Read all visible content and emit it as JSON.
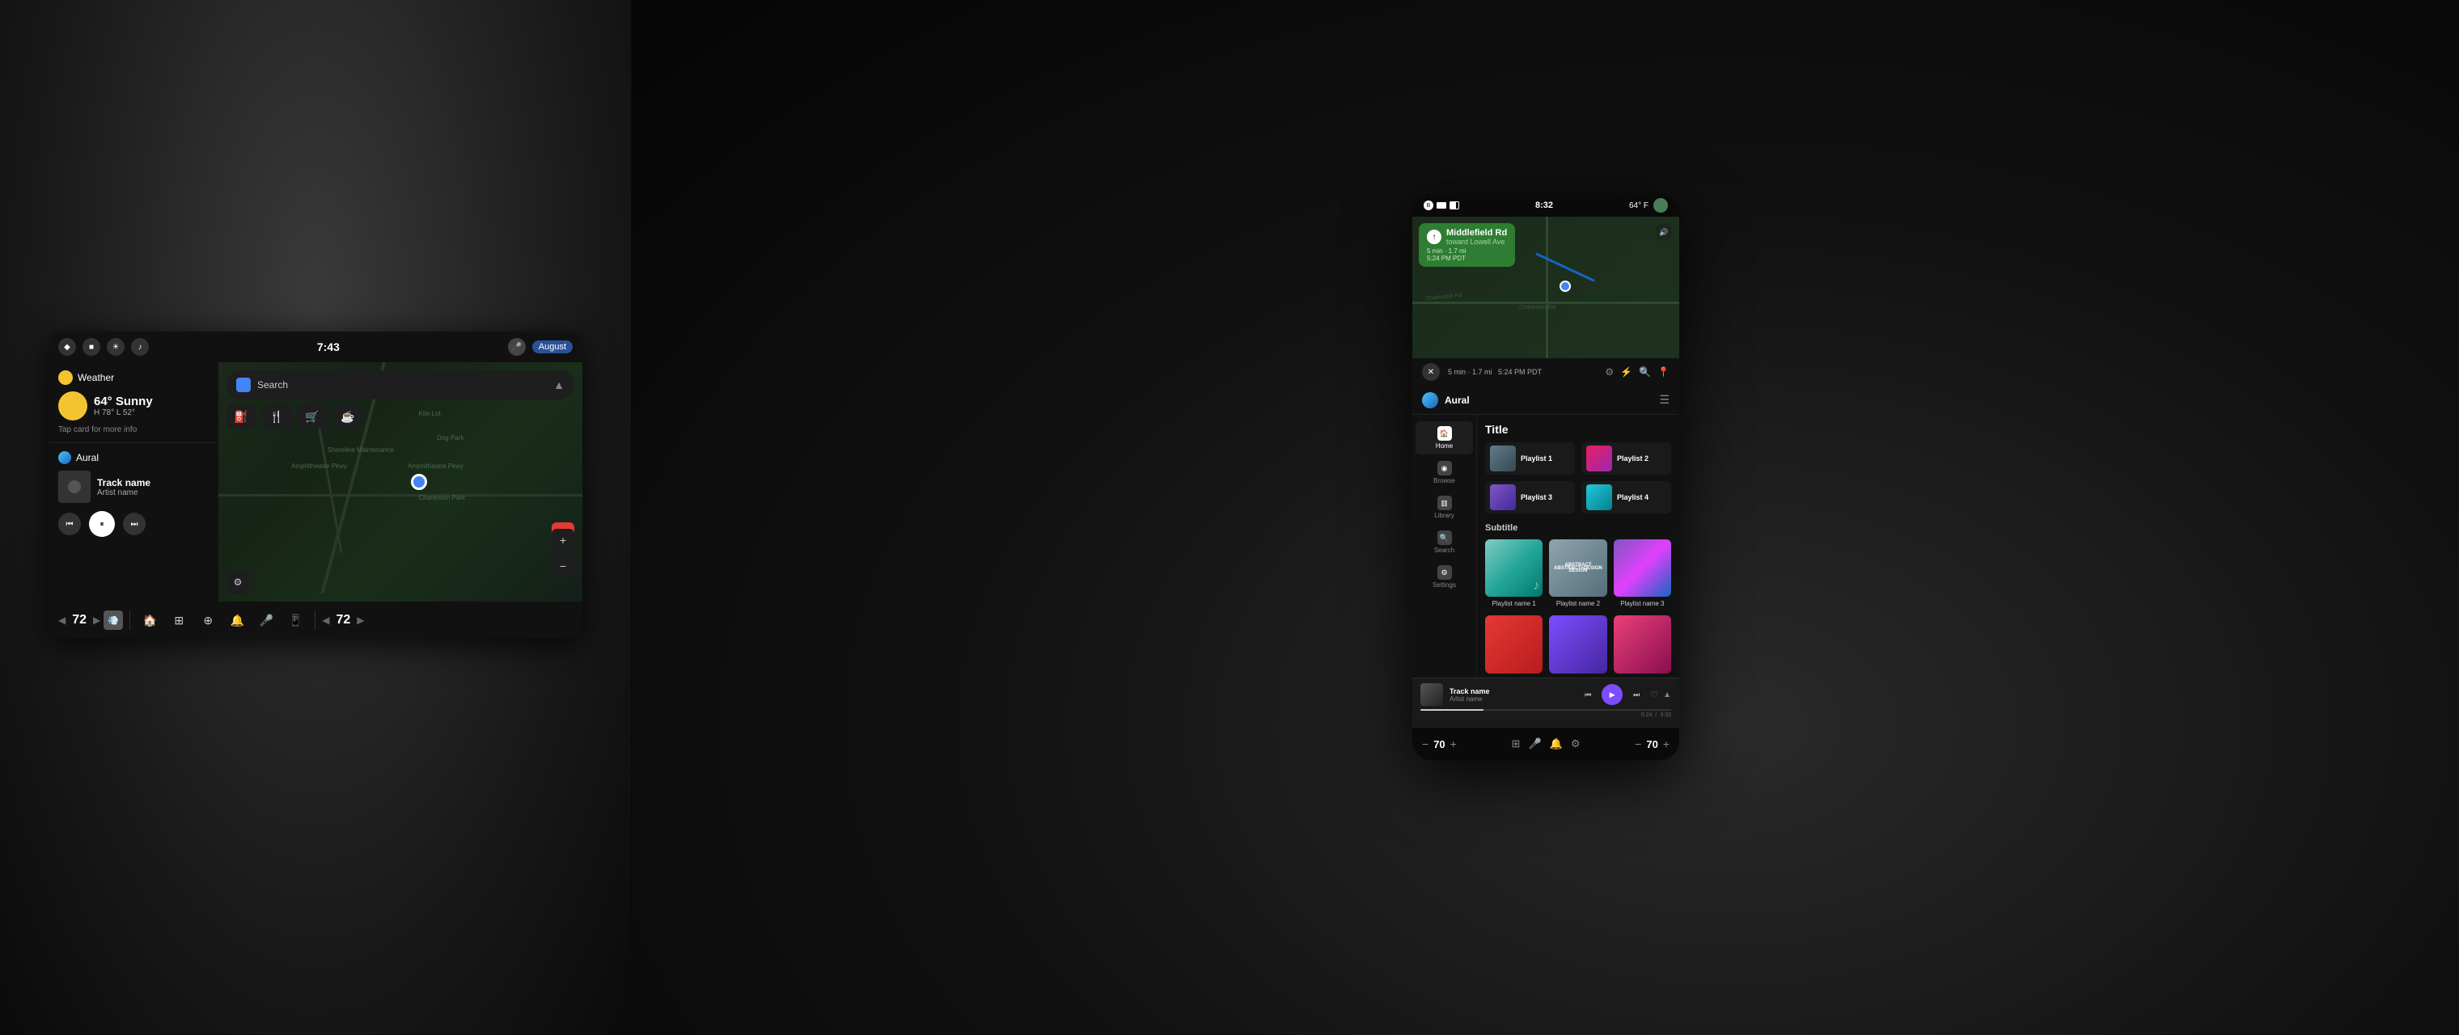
{
  "left": {
    "statusbar": {
      "time": "7:43",
      "user": "August",
      "icons": [
        "bluetooth",
        "signal",
        "brightness",
        "volume"
      ]
    },
    "weather": {
      "title": "Weather",
      "temp": "64° Sunny",
      "high_low": "H 78° L 52°",
      "tap_info": "Tap card for more info"
    },
    "music": {
      "app_name": "Aural",
      "track_name": "Track name",
      "artist_name": "Artist name"
    },
    "map": {
      "search_placeholder": "Search",
      "places": [
        "Kite Lot",
        "Dog Park",
        "Shoreline Maintenance",
        "Charleston Park",
        "Amphitheatre Pkwy"
      ]
    },
    "navbar": {
      "temp_left": "72",
      "temp_right": "72",
      "icons": [
        "home",
        "apps",
        "fan",
        "bell",
        "mic",
        "phone"
      ]
    }
  },
  "right": {
    "statusbar": {
      "time": "8:32",
      "temp": "64° F"
    },
    "navigation": {
      "road": "Middlefield Rd",
      "toward": "toward Lowell Ave",
      "eta": "5 min · 1.7 mi",
      "time": "5:24 PM PDT"
    },
    "app": {
      "name": "Aural",
      "title": "Title",
      "subtitle": "Subtitle"
    },
    "sidebar": {
      "items": [
        {
          "label": "Home",
          "icon": "home",
          "active": true
        },
        {
          "label": "Browse",
          "icon": "browse"
        },
        {
          "label": "Library",
          "icon": "library"
        },
        {
          "label": "Search",
          "icon": "search"
        },
        {
          "label": "Settings",
          "icon": "settings"
        }
      ]
    },
    "playlists": [
      {
        "name": "Playlist 1",
        "style": "pl-1"
      },
      {
        "name": "Playlist 2",
        "style": "pl-2"
      },
      {
        "name": "Playlist 3",
        "style": "pl-3"
      },
      {
        "name": "Playlist 4",
        "style": "pl-4"
      }
    ],
    "featured": [
      {
        "name": "Playlist name 1",
        "style": "ft-1"
      },
      {
        "name": "Playlist name 2",
        "style": "ft-2"
      },
      {
        "name": "Playlist name 3",
        "style": "ft-3"
      }
    ],
    "second_row": [
      {
        "name": "",
        "style": "sr-1"
      },
      {
        "name": "",
        "style": "sr-2"
      },
      {
        "name": "",
        "style": "sr-3"
      }
    ],
    "now_playing": {
      "track_name": "Track name",
      "artist_name": "Artist name",
      "time_current": "0:24",
      "time_total": "3:32",
      "progress": 25
    },
    "bottom": {
      "temp_left": "70",
      "temp_right": "70"
    }
  }
}
